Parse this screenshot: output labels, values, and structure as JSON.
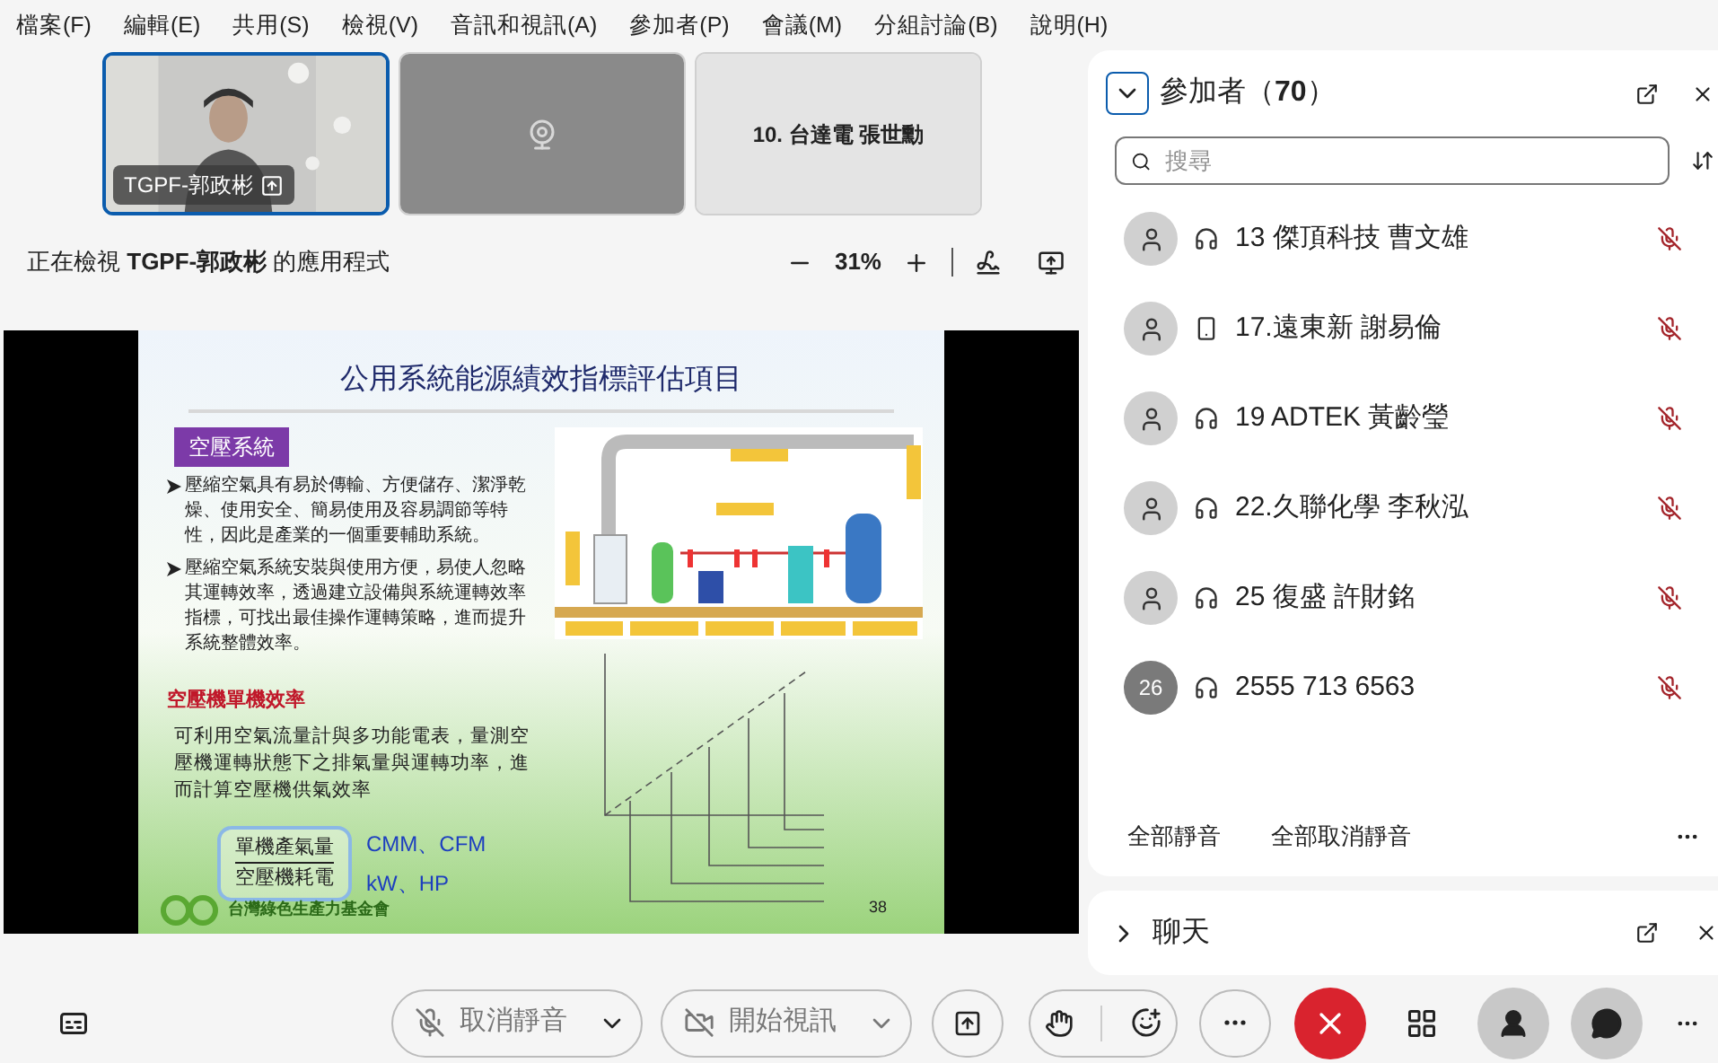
{
  "menu": [
    "檔案(F)",
    "編輯(E)",
    "共用(S)",
    "檢視(V)",
    "音訊和視訊(A)",
    "參加者(P)",
    "會議(M)",
    "分組討論(B)",
    "說明(H)"
  ],
  "video_tiles": [
    {
      "kind": "video",
      "name": "TGPF-郭政彬",
      "selected": true
    },
    {
      "kind": "camera_off",
      "selected": false
    },
    {
      "kind": "name",
      "name": "10. 台達電 張世勳",
      "selected": false
    }
  ],
  "viewing_bar": {
    "text": "正在檢視 **TGPF-郭政彬** 的應用程式",
    "zoom": "31%"
  },
  "slide": {
    "title": "公用系統能源績效指標評估項目",
    "section": "空壓系統",
    "bullets": [
      "壓縮空氣具有易於傳輸、方便儲存、潔淨乾燥、使用安全、簡易使用及容易調節等特性，因此是產業的一個重要輔助系統。",
      "壓縮空氣系統安裝與使用方便，易使人忽略其運轉效率，透過建立設備與系統運轉效率指標，可找出最佳操作運轉策略，進而提升系統整體效率。"
    ],
    "heading": "空壓機單機效率",
    "paragraph": "可利用空氣流量計與多功能電表，量測空壓機運轉狀態下之排氣量與運轉功率，進而計算空壓機供氣效率",
    "numerator": "單機產氣量",
    "denominator": "空壓機耗電",
    "units_top": "CMM、CFM",
    "units_bottom": "kW、HP",
    "logo_text": "台灣綠色生產力基金會",
    "page": "38"
  },
  "participants": {
    "title": "參加者（**70**）",
    "expanded": true,
    "search_placeholder": "搜尋",
    "items": [
      {
        "avatar": {
          "kind": "person"
        },
        "device": {
          "kind": "headset"
        },
        "name": "13 傑頂科技 曹文雄",
        "muted": true
      },
      {
        "avatar": {
          "kind": "person"
        },
        "device": {
          "kind": "phone"
        },
        "name": "17.遠東新 謝易倫",
        "muted": true
      },
      {
        "avatar": {
          "kind": "person"
        },
        "device": {
          "kind": "headset"
        },
        "name": "19 ADTEK 黃齡瑩",
        "muted": true
      },
      {
        "avatar": {
          "kind": "person"
        },
        "device": {
          "kind": "headset"
        },
        "name": "22.久聯化學 李秋泓",
        "muted": true
      },
      {
        "avatar": {
          "kind": "person"
        },
        "device": {
          "kind": "headset"
        },
        "name": "25 復盛 許財銘",
        "muted": true
      },
      {
        "avatar": {
          "kind": "number",
          "text": "26"
        },
        "device": {
          "kind": "headset"
        },
        "name": "2555 713 6563",
        "muted": true
      }
    ],
    "actions": [
      "全部靜音",
      "全部取消靜音"
    ]
  },
  "chat": {
    "title": "聊天",
    "expanded": false
  },
  "toolbar": {
    "mute_label": "取消靜音",
    "video_label": "開始視訊",
    "participants_active": true,
    "chat_active": true
  }
}
